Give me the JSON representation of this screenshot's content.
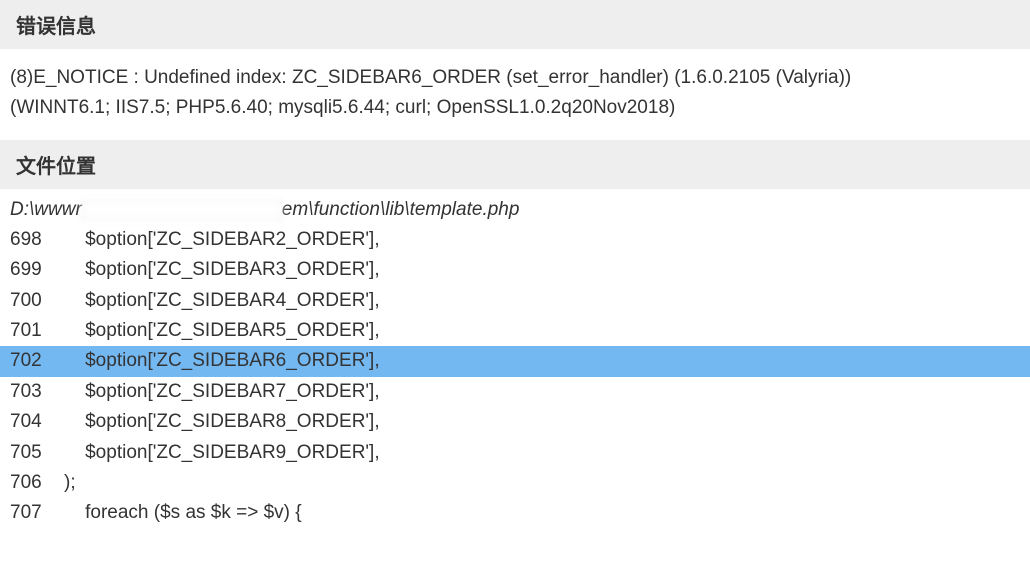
{
  "sections": {
    "error_info_header": "错误信息",
    "file_location_header": "文件位置"
  },
  "error_message": {
    "line1": "(8)E_NOTICE : Undefined index: ZC_SIDEBAR6_ORDER (set_error_handler) (1.6.0.2105 (Valyria))",
    "line2": "(WINNT6.1; IIS7.5; PHP5.6.40; mysqli5.6.44; curl; OpenSSL1.0.2q20Nov2018)"
  },
  "file_path": {
    "prefix": "D:\\wwwr",
    "suffix": "em\\function\\lib\\template.php"
  },
  "code_lines": [
    {
      "num": "698",
      "text": "$option['ZC_SIDEBAR2_ORDER'],",
      "highlighted": false
    },
    {
      "num": "699",
      "text": "$option['ZC_SIDEBAR3_ORDER'],",
      "highlighted": false
    },
    {
      "num": "700",
      "text": "$option['ZC_SIDEBAR4_ORDER'],",
      "highlighted": false
    },
    {
      "num": "701",
      "text": "$option['ZC_SIDEBAR5_ORDER'],",
      "highlighted": false
    },
    {
      "num": "702",
      "text": "$option['ZC_SIDEBAR6_ORDER'],",
      "highlighted": true
    },
    {
      "num": "703",
      "text": "$option['ZC_SIDEBAR7_ORDER'],",
      "highlighted": false
    },
    {
      "num": "704",
      "text": "$option['ZC_SIDEBAR8_ORDER'],",
      "highlighted": false
    },
    {
      "num": "705",
      "text": "$option['ZC_SIDEBAR9_ORDER'],",
      "highlighted": false
    },
    {
      "num": "706",
      "text": ");",
      "highlighted": false,
      "noindent": true
    },
    {
      "num": "707",
      "text": "foreach ($s as $k => $v) {",
      "highlighted": false
    }
  ]
}
